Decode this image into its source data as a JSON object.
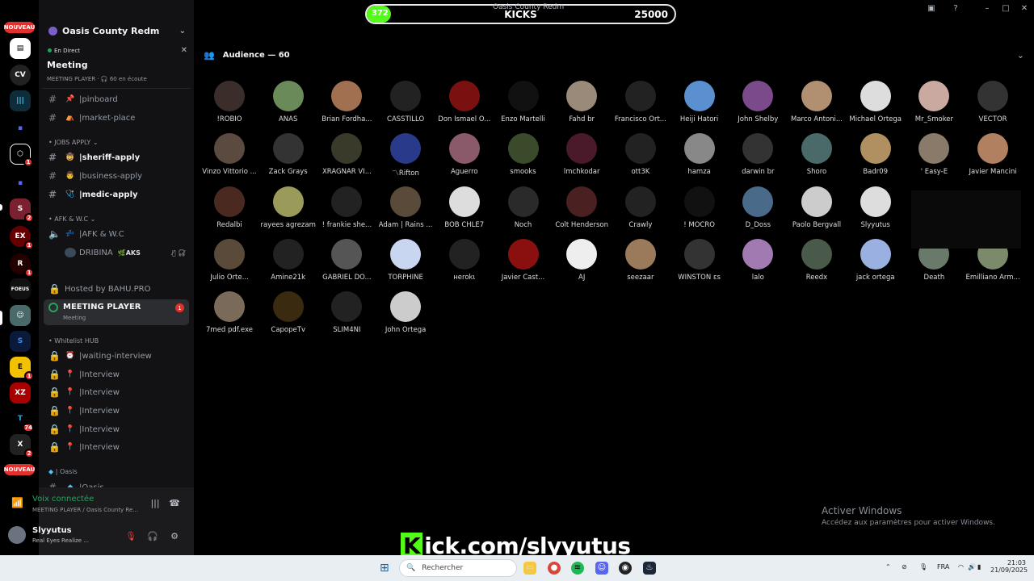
{
  "window": {
    "title": "Oasis County Redm"
  },
  "overlay": {
    "current": "372",
    "label": "KICKS",
    "target": "25000",
    "progress": 0.015,
    "kick_text": "Kick.com/slyyutus"
  },
  "rail": {
    "nouveau": "NOUVEAU",
    "nouveau2": "NOUVEAU",
    "badges": [
      "1",
      "2",
      "1",
      "1",
      "1",
      "74",
      "2"
    ]
  },
  "server": {
    "name": "Oasis County Redm"
  },
  "event": {
    "live": "En Direct",
    "title": "Meeting",
    "subtitle": "MEETING PLAYER · 🎧 60 en écoute"
  },
  "channels": {
    "pinboard": "pinboard",
    "market": "market-place",
    "cat_jobs": "JOBS APPLY",
    "sheriff": "sheriff-apply",
    "business": "business-apply",
    "medic": "medic-apply",
    "cat_afk": "AFK & W.C",
    "afk": "AFK & W.C",
    "dribina": "DRIBINA",
    "aks": "AKS",
    "hosted": "Hosted by BAHU.PRO",
    "meeting": "MEETING PLAYER",
    "meeting_sub": "Meeting",
    "meeting_badge": "1",
    "cat_wl": "Whitelist HUB",
    "waiting": "waiting-interview",
    "interview": "Interview",
    "cat_oasis": "Oasis",
    "oasis": "Oasis"
  },
  "voice": {
    "status": "Voix connectée",
    "channel": "MEETING PLAYER / Oasis County Re..."
  },
  "user": {
    "name": "Slyyutus",
    "status": "Real Eyes Realize ..."
  },
  "audience": {
    "title": "Audience — 60"
  },
  "members": [
    "!ROBIO",
    "ANAS",
    "Brian Fordha...",
    "CASSTILLO",
    "Don Ismael O...",
    "Enzo Martelli",
    "Fahd br",
    "Francisco Ort...",
    "Heiji Hatori",
    "John Shelby",
    "Marco Antoni...",
    "Michael Ortega",
    "Mr_Smoker",
    "VECTOR",
    "Vinzo Vittorio ...",
    "Zack Grays",
    "XRAGNAR VI...",
    "〽Rifton",
    "Aguerro",
    "smooks",
    "lmchkodar",
    "ott3K",
    "hamza",
    "darwin br",
    "Shoro",
    "Badr09",
    "' Easy-E",
    "Javier Mancini",
    "Redalbi",
    "rayees agrezam",
    "! frankie she...",
    "Adam | Rains ...",
    "BOB CHLE7",
    "Noch",
    "Colt Henderson",
    "Crawly",
    "! MOCRO",
    "D_Doss",
    "Paolo Bergvall",
    "Slyyutus",
    "",
    "",
    "Julio Orte...",
    "Amine21k",
    "GABRIEL DO...",
    "TORPHINE",
    "нerokι",
    "Javier Cast...",
    "AJ",
    "seezaar",
    "WINSTON ɛs",
    "lalo",
    "Reedx",
    "jack ortega",
    "Death",
    "Emilliano Arm...",
    "7med pdf.exe",
    "CapopeTv",
    "SLIM4NI",
    "John Ortega"
  ],
  "member_colors": [
    "#3a2d2a",
    "#6b8a5a",
    "#a07050",
    "#222",
    "#7a1010",
    "#111",
    "#9a8a7a",
    "#222",
    "#5a8fd0",
    "#7a4a8a",
    "#b09070",
    "#ddd",
    "#c9a9a0",
    "#333",
    "#5a4a40",
    "#333",
    "#3a3a2a",
    "#2a3a8a",
    "#8a5a6a",
    "#3a4a2a",
    "#4a1a2a",
    "#222",
    "#888",
    "#333",
    "#4a6a6a",
    "#b09060",
    "#8a7a6a",
    "#b08060",
    "#4a2a20",
    "#9a9a5a",
    "#222",
    "#5a4a3a",
    "#ddd",
    "#2a2a2a",
    "#4a2020",
    "#222",
    "#111",
    "#4a6a8a",
    "#ccc",
    "#ddd",
    "#000",
    "#000",
    "#5a4a3a",
    "#222",
    "#555",
    "#c9d6f0",
    "#222",
    "#8a1010",
    "#eee",
    "#9a7a5a",
    "#333",
    "#a07ab0",
    "#4a5a4a",
    "#9ab0e0",
    "#6a7a6a",
    "#7a8a6a",
    "#7a6a5a",
    "#3a2a10",
    "#222",
    "#ccc"
  ],
  "activate": {
    "title": "Activer Windows",
    "sub": "Accédez aux paramètres pour activer Windows."
  },
  "taskbar": {
    "search": "Rechercher",
    "lang": "FRA",
    "time": "21:03",
    "date": "21/09/2025"
  }
}
